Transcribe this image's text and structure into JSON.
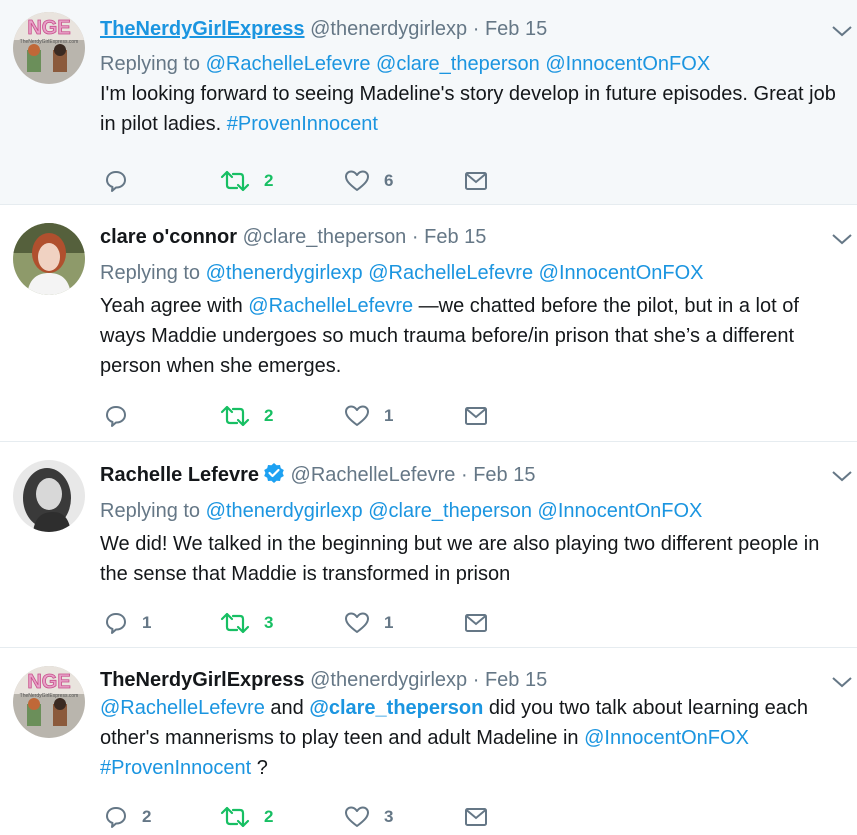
{
  "colors": {
    "link": "#1b95e0",
    "retweet": "#17bf63",
    "muted": "#657786",
    "highlight_bg": "#f5f8fa"
  },
  "tweets": [
    {
      "name": "TheNerdyGirlExpress",
      "handle": "@thenerdygirlexp",
      "dot": "·",
      "date": "Feb 15",
      "reply_label": "Replying to",
      "reply_mentions": [
        "@RachelleLefevre",
        "@clare_theperson",
        "@InnocentOnFOX"
      ],
      "text_parts": [
        "I'm looking forward to seeing Madeline's  story develop in future episodes. Great job in pilot ladies. ",
        "#ProvenInnocent"
      ],
      "replies": "",
      "retweets": "2",
      "likes": "6",
      "avatar_icon": "nge-logo-avatar"
    },
    {
      "name": "clare o'connor",
      "handle": "@clare_theperson",
      "dot": "·",
      "date": "Feb 15",
      "reply_label": "Replying to",
      "reply_mentions": [
        "@thenerdygirlexp",
        "@RachelleLefevre",
        "@InnocentOnFOX"
      ],
      "text_parts": [
        "Yeah agree with ",
        "@RachelleLefevre",
        " —we chatted before the pilot, but in a lot of ways Maddie undergoes so much trauma before/in prison that she’s a different person when she emerges."
      ],
      "replies": "",
      "retweets": "2",
      "likes": "1",
      "avatar_icon": "person-avatar"
    },
    {
      "name": "Rachelle Lefevre",
      "handle": "@RachelleLefevre",
      "dot": "·",
      "date": "Feb 15",
      "reply_label": "Replying to",
      "reply_mentions": [
        "@thenerdygirlexp",
        "@clare_theperson",
        "@InnocentOnFOX"
      ],
      "text_parts": [
        "We did! We talked in the beginning but we are also playing two different people in the sense that Maddie is transformed in prison"
      ],
      "replies": "1",
      "retweets": "3",
      "likes": "1",
      "avatar_icon": "person-avatar"
    },
    {
      "name": "TheNerdyGirlExpress",
      "handle": "@thenerdygirlexp",
      "dot": "·",
      "date": "Feb 15",
      "text_parts": [
        "@RachelleLefevre",
        " and ",
        "@clare_theperson",
        " did you two talk about learning each other's mannerisms  to play teen and adult Madeline in ",
        "@InnocentOnFOX",
        " ",
        "#ProvenInnocent",
        " ?"
      ],
      "replies": "2",
      "retweets": "2",
      "likes": "3",
      "avatar_icon": "nge-logo-avatar"
    }
  ],
  "avatar_text": "NGE",
  "avatar_subtext": "TheNerdyGirlExpress.com"
}
